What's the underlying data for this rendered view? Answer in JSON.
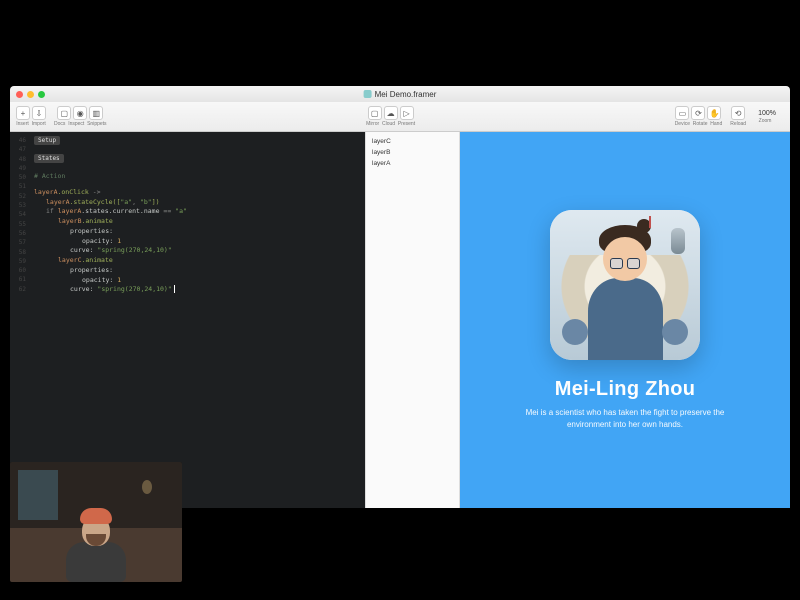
{
  "window": {
    "title": "Mei Demo.framer"
  },
  "toolbar": {
    "left": {
      "insert": "Insert",
      "import": "Import",
      "docs": "Docs",
      "inspect": "Inspect",
      "snippets": "Snippets"
    },
    "center": {
      "mirror": "Mirror",
      "cloud": "Cloud",
      "present": "Present"
    },
    "right": {
      "device": "Device",
      "rotate": "Rotate",
      "hand": "Hand",
      "reload": "Reload",
      "zoomLabel": "Zoom",
      "zoom": "100%"
    }
  },
  "editor": {
    "fold_setup": "Setup",
    "fold_states": "States",
    "section_comment": "# Action",
    "lines": {
      "l1a": "layerA",
      "l1b": ".onClick",
      "l1c": " ->",
      "l2a": "layerA",
      "l2b": ".stateCycle([",
      "l2s1": "\"a\"",
      "l2p": ", ",
      "l2s2": "\"b\"",
      "l2e": "])",
      "l3a": "if ",
      "l3b": "layerA",
      "l3c": ".states.current.name ",
      "l3d": "== ",
      "l3e": "\"a\"",
      "l4a": "layerB",
      "l4b": ".animate",
      "l5": "properties:",
      "l6a": "opacity: ",
      "l6b": "1",
      "l7a": "curve: ",
      "l7b": "\"spring(270,24,10)\"",
      "l8a": "layerC",
      "l8b": ".animate",
      "l9": "properties:",
      "l10a": "opacity: ",
      "l10b": "1",
      "l11a": "curve: ",
      "l11b": "\"spring(270,24,10)\""
    },
    "line_numbers": [
      "46",
      "47",
      "48",
      "49",
      "50",
      "51",
      "52",
      "53",
      "54",
      "55",
      "56",
      "57",
      "58",
      "59",
      "60",
      "61",
      "62"
    ]
  },
  "layers": {
    "items": [
      "layerC",
      "layerB",
      "layerA"
    ]
  },
  "preview": {
    "title": "Mei-Ling Zhou",
    "subtitle": "Mei is a scientist who has taken the fight to preserve the environment into her own hands."
  }
}
